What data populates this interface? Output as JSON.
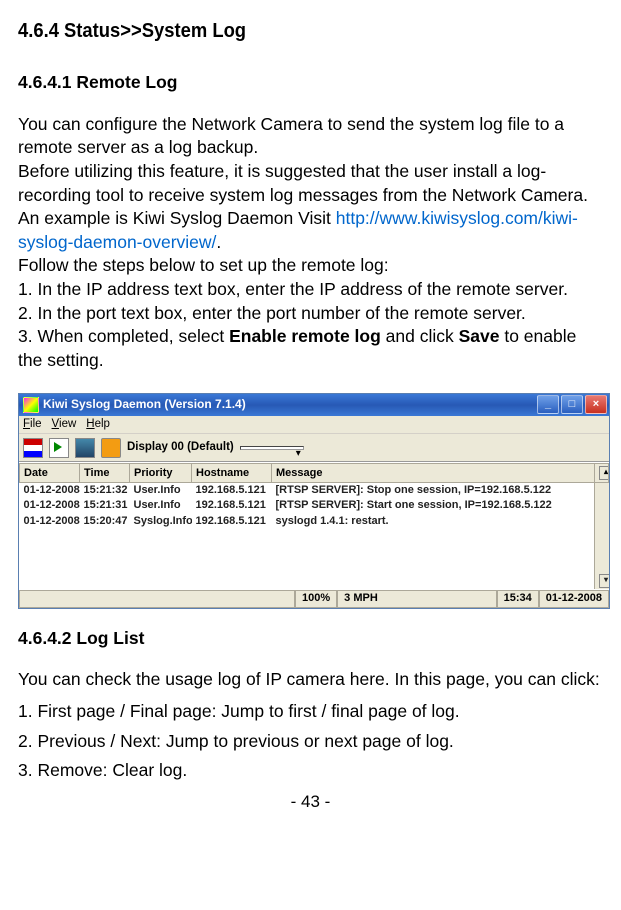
{
  "section_heading": "4.6.4 Status>>System Log",
  "sub1_heading": "4.6.4.1 Remote Log",
  "para1_a": "You can configure the Network Camera to send the system log file to a remote server as a log backup.",
  "para1_b_prefix": "Before utilizing this feature, it is suggested that the user install a log-recording tool to receive system log messages from the Network Camera.  An example is Kiwi Syslog Daemon Visit ",
  "para1_b_link": "http://www.kiwisyslog.com/kiwi-syslog-daemon-overview/",
  "para1_b_suffix": ".",
  "para1_c": "Follow the steps below to set up the remote log:",
  "step1": "1. In the IP address text box, enter the IP address of the remote server.",
  "step2": "2. In the port text box, enter the port number of the remote server.",
  "step3_prefix": "3. When completed, select ",
  "step3_bold1": "Enable remote log",
  "step3_mid": " and click ",
  "step3_bold2": "Save",
  "step3_suffix": " to enable the setting.",
  "app": {
    "title": "Kiwi Syslog Daemon (Version 7.1.4)",
    "menu": {
      "file": "File",
      "view": "View",
      "help": "Help"
    },
    "toolbar_label": "Display 00 (Default)",
    "columns": {
      "date": "Date",
      "time": "Time",
      "priority": "Priority",
      "hostname": "Hostname",
      "message": "Message"
    },
    "rows": [
      {
        "date": "01-12-2008",
        "time": "15:21:32",
        "priority": "User.Info",
        "hostname": "192.168.5.121",
        "message": "[RTSP SERVER]: Stop one session, IP=192.168.5.122"
      },
      {
        "date": "01-12-2008",
        "time": "15:21:31",
        "priority": "User.Info",
        "hostname": "192.168.5.121",
        "message": "[RTSP SERVER]: Start one session, IP=192.168.5.122"
      },
      {
        "date": "01-12-2008",
        "time": "15:20:47",
        "priority": "Syslog.Info",
        "hostname": "192.168.5.121",
        "message": "syslogd 1.4.1: restart."
      }
    ],
    "status": {
      "pct": "100%",
      "mph": "3 MPH",
      "time": "15:34",
      "date": "01-12-2008"
    }
  },
  "sub2_heading": "4.6.4.2 Log List",
  "para2": "You can check the usage log of IP camera here. In this page, you can click:",
  "ll1": "1. First page / Final page: Jump to first / final page of log.",
  "ll2": "2. Previous / Next: Jump to previous or next page of log.",
  "ll3": "3. Remove: Clear log.",
  "page_number": "- 43 -"
}
